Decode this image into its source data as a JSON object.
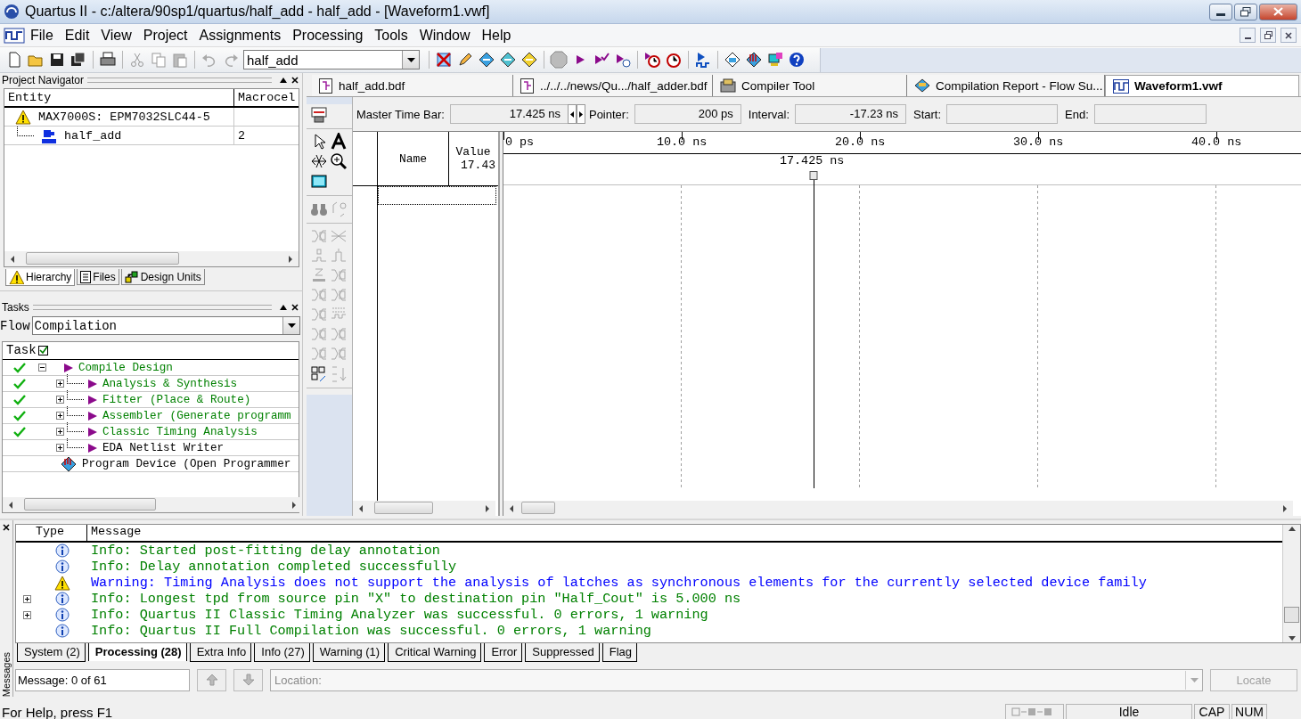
{
  "window": {
    "title": "Quartus II - c:/altera/90sp1/quartus/half_add - half_add - [Waveform1.vwf]"
  },
  "menu": [
    "File",
    "Edit",
    "View",
    "Project",
    "Assignments",
    "Processing",
    "Tools",
    "Window",
    "Help"
  ],
  "toolbar": {
    "project": "half_add"
  },
  "project_navigator": {
    "title": "Project Navigator",
    "columns": [
      "Entity",
      "Macrocel"
    ],
    "rows": [
      {
        "kind": "device",
        "entity": "MAX7000S: EPM7032SLC44-5",
        "macrocells": "",
        "children": [
          {
            "kind": "design",
            "entity": "half_add",
            "macrocells": "2"
          }
        ]
      }
    ],
    "tabs": [
      {
        "kind": "hierarchy",
        "label": "Hierarchy",
        "selected": true
      },
      {
        "kind": "files",
        "label": "Files",
        "selected": false
      },
      {
        "kind": "units",
        "label": "Design Units",
        "selected": false
      }
    ]
  },
  "tasks": {
    "title": "Tasks",
    "flow_label": "Flow",
    "flow": "Compilation",
    "column": "Task",
    "items": [
      {
        "kind": "flow",
        "label": "Compile Design",
        "done": true,
        "expanded": true,
        "children": [
          {
            "kind": "flow",
            "label": "Analysis & Synthesis",
            "done": true,
            "expanded": false
          },
          {
            "kind": "flow",
            "label": "Fitter (Place & Route)",
            "done": true,
            "expanded": false
          },
          {
            "kind": "flow",
            "label": "Assembler (Generate programm",
            "done": true,
            "expanded": false
          },
          {
            "kind": "flow",
            "label": "Classic Timing Analysis",
            "done": true,
            "expanded": false
          },
          {
            "kind": "flow",
            "label": "EDA Netlist Writer",
            "done": false,
            "expanded": false
          }
        ]
      },
      {
        "kind": "program",
        "label": "Program Device (Open Programmer",
        "done": false
      }
    ]
  },
  "document_tabs": [
    {
      "kind": "bdf",
      "label": "half_add.bdf",
      "selected": false
    },
    {
      "kind": "bdf",
      "label": "../../../news/Qu.../half_adder.bdf",
      "selected": false
    },
    {
      "kind": "tool",
      "label": "Compiler Tool",
      "selected": false
    },
    {
      "kind": "report",
      "label": "Compilation Report - Flow Su...",
      "selected": false
    },
    {
      "kind": "waveform",
      "label": "Waveform1.vwf",
      "selected": true
    }
  ],
  "waveform": {
    "master_time_bar_label": "Master Time Bar:",
    "master_time_bar": "17.425 ns",
    "pointer_label": "Pointer:",
    "pointer": "200 ps",
    "interval_label": "Interval:",
    "interval": "-17.23 ns",
    "start_label": "Start:",
    "end_label": "End:",
    "name_header": "Name",
    "value_header": "Value",
    "value_time": "17.43",
    "time_ticks": [
      "0 ps",
      "10.0 ns",
      "20.0 ns",
      "30.0 ns",
      "40.0 ns"
    ],
    "cursor_label": "17.425 ns"
  },
  "messages": {
    "side_label": "Messages",
    "columns": [
      "Type",
      "Message"
    ],
    "rows": [
      {
        "kind": "info",
        "text": "Info: Started post-fitting delay annotation",
        "expandable": false
      },
      {
        "kind": "info",
        "text": "Info: Delay annotation completed successfully",
        "expandable": false
      },
      {
        "kind": "warning",
        "text": "Warning: Timing Analysis does not support the analysis of latches as synchronous elements for the currently selected device family",
        "expandable": false
      },
      {
        "kind": "info",
        "text": "Info: Longest tpd from source pin \"X\" to destination pin \"Half_Cout\" is 5.000 ns",
        "expandable": true
      },
      {
        "kind": "info",
        "text": "Info: Quartus II Classic Timing Analyzer was successful. 0 errors, 1 warning",
        "expandable": true
      },
      {
        "kind": "info",
        "text": "Info: Quartus II Full Compilation was successful. 0 errors, 1 warning",
        "expandable": false
      }
    ],
    "tabs": [
      {
        "label": "System (2)",
        "selected": false
      },
      {
        "label": "Processing (28)",
        "selected": true
      },
      {
        "label": "Extra Info",
        "selected": false
      },
      {
        "label": "Info (27)",
        "selected": false
      },
      {
        "label": "Warning (1)",
        "selected": false
      },
      {
        "label": "Critical Warning",
        "selected": false
      },
      {
        "label": "Error",
        "selected": false
      },
      {
        "label": "Suppressed",
        "selected": false
      },
      {
        "label": "Flag",
        "selected": false
      }
    ],
    "count": "Message: 0 of 61",
    "location_placeholder": "Location:",
    "locate_button": "Locate"
  },
  "status_bar": {
    "help": "For Help, press F1",
    "state": "Idle",
    "indicators": [
      "CAP",
      "NUM"
    ]
  }
}
